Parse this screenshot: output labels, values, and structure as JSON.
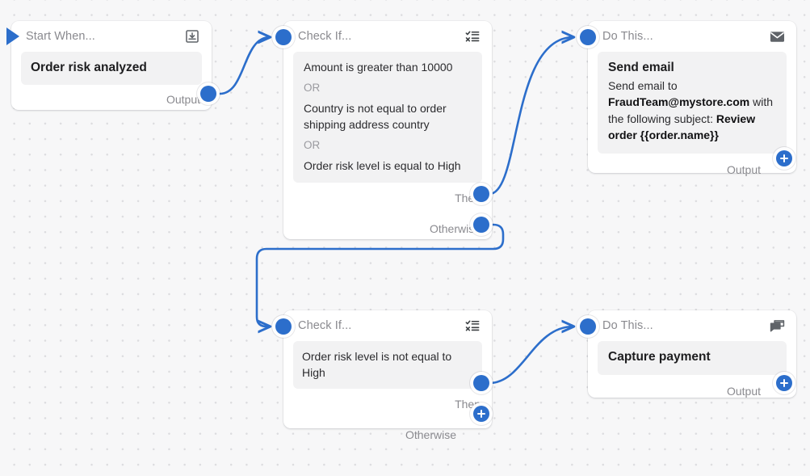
{
  "canvas": {
    "background_color": "#f7f7f8",
    "dot_color": "#dcdcdf",
    "accent_color": "#2c6ecb",
    "panel_color": "#f2f2f3"
  },
  "nodes": {
    "start": {
      "header_title": "Start When...",
      "icon": "inbox-download-icon",
      "trigger_label": "Order risk analyzed",
      "output_label": "Output"
    },
    "check_fraud": {
      "header_title": "Check If...",
      "icon": "checklist-icon",
      "conditions": [
        "Amount is greater than 10000",
        "Country is not equal to order shipping address country",
        "Order risk level is equal to High"
      ],
      "operator": "OR",
      "then_label": "Then",
      "otherwise_label": "Otherwise"
    },
    "send_email": {
      "header_title": "Do This...",
      "icon": "envelope-icon",
      "action_title": "Send email",
      "body_prefix": "Send email to ",
      "body_recipient": "FraudTeam@mystore.com",
      "body_middle": " with the following subject: ",
      "body_subject": "Review order {{order.name}}",
      "output_label": "Output"
    },
    "check_safe": {
      "header_title": "Check If...",
      "icon": "checklist-icon",
      "conditions": [
        "Order risk level is not equal to High"
      ],
      "then_label": "Then",
      "otherwise_label": "Otherwise"
    },
    "capture_payment": {
      "header_title": "Do This...",
      "icon": "credit-card-icon",
      "action_title": "Capture payment",
      "output_label": "Output"
    }
  }
}
